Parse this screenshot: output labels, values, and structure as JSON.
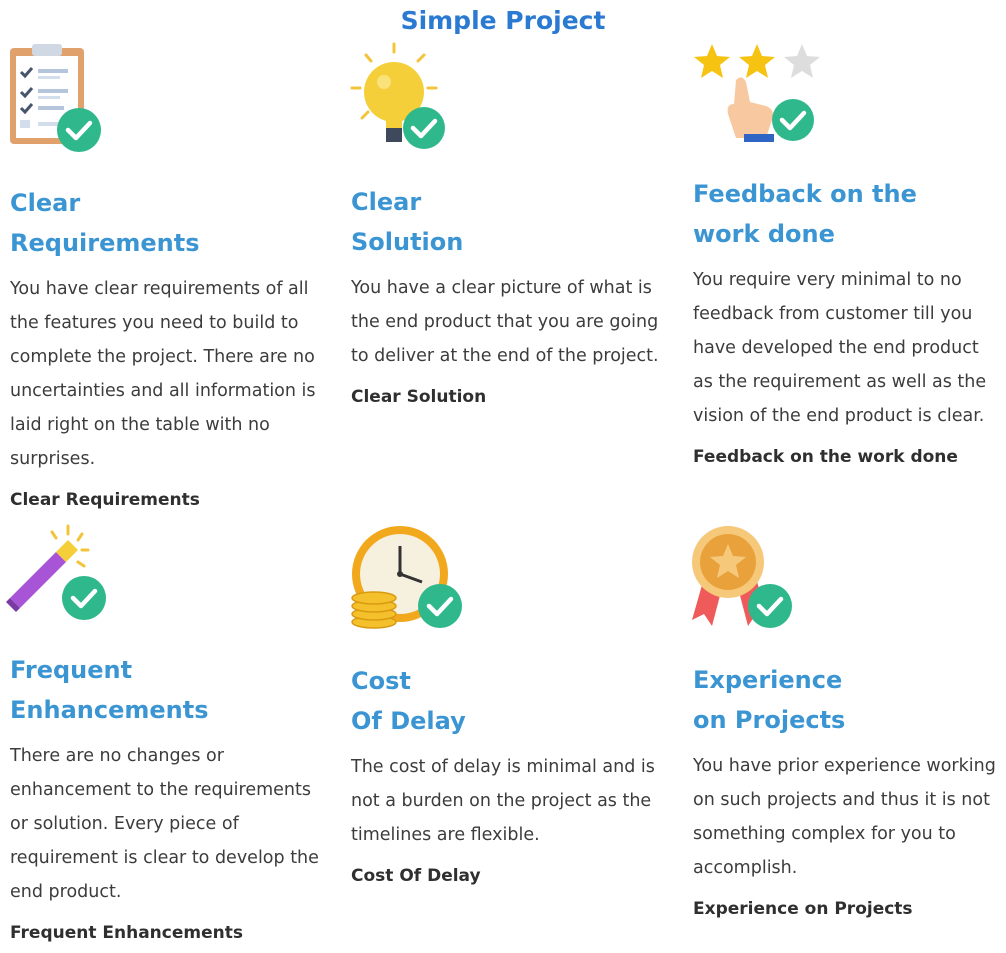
{
  "page": {
    "title": "Simple Project"
  },
  "cards": [
    {
      "icon": "clipboard-checklist-icon",
      "title_line1": "Clear",
      "title_line2": "Requirements",
      "description": "You have clear requirements of all the features you need to build to complete the project. There are no uncertainties and all information is laid right on the table with no surprises.",
      "footer": "Clear Requirements"
    },
    {
      "icon": "lightbulb-icon",
      "title_line1": "Clear",
      "title_line2": "Solution",
      "description": "You have a clear picture of what is the end product that you are going to deliver at the end of the project.",
      "footer": "Clear Solution"
    },
    {
      "icon": "star-rating-icon",
      "title_line1": "Feedback on the",
      "title_line2": "work done",
      "description": "You require very minimal to no feedback from customer till you have developed the end product as the requirement as well as the vision of the end product is clear.",
      "footer": "Feedback on the work done"
    },
    {
      "icon": "magic-wand-icon",
      "title_line1": "Frequent",
      "title_line2": "Enhancements",
      "description": "There are no changes or enhancement to the requirements or solution. Every piece of requirement is clear to develop the end product.",
      "footer": "Frequent Enhancements"
    },
    {
      "icon": "clock-coins-icon",
      "title_line1": "Cost",
      "title_line2": "Of Delay",
      "description": "The cost of delay is minimal and is not a burden on the project as the timelines are flexible.",
      "footer": "Cost Of Delay"
    },
    {
      "icon": "award-medal-icon",
      "title_line1": "Experience",
      "title_line2": "on Projects",
      "description": "You have prior experience working on such projects and thus it is not something complex for you to accomplish.",
      "footer": "Experience on Projects"
    }
  ],
  "colors": {
    "title": "#2a7ad2",
    "heading": "#3b95d3",
    "check": "#2fb88b",
    "text": "#3c3c3c"
  }
}
